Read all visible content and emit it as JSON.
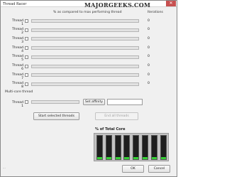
{
  "window": {
    "title": "Thread Racer",
    "watermark": "MAJORGEEKS.COM",
    "close_label": "✕"
  },
  "header": {
    "percent_label": "% as compared to max performing thread",
    "iterations_label": "Iterations"
  },
  "threads": [
    {
      "label": "Thread 1",
      "iterations": "0",
      "progress": 0
    },
    {
      "label": "Thread 2",
      "iterations": "0",
      "progress": 0
    },
    {
      "label": "Thread 3",
      "iterations": "0",
      "progress": 0
    },
    {
      "label": "Thread 4",
      "iterations": "0",
      "progress": 0
    },
    {
      "label": "Thread 5",
      "iterations": "0",
      "progress": 0
    },
    {
      "label": "Thread 6",
      "iterations": "0",
      "progress": 0
    },
    {
      "label": "Thread 7",
      "iterations": "0",
      "progress": 0
    },
    {
      "label": "Thread 8",
      "iterations": "0",
      "progress": 0
    }
  ],
  "multicore": {
    "section_label": "Multi-core thread",
    "thread_label": "Thread 1",
    "affinity_button": "Set affinity",
    "affinity_value": ""
  },
  "actions": {
    "start_label": "Start selected threads",
    "end_label": "End all threads",
    "ok_label": "OK",
    "cancel_label": "Cancel"
  },
  "core_usage": {
    "title": "% of Total Core",
    "levels": [
      0.08,
      0.08,
      0.08,
      0.08,
      0.08,
      0.08,
      0.08,
      0.08
    ],
    "fill_color": "#34d134",
    "background_color": "#1e1e1e"
  },
  "colors": {
    "close_button": "#c75050",
    "progress_fill": "#4bb84b"
  },
  "resize_grip": "···"
}
